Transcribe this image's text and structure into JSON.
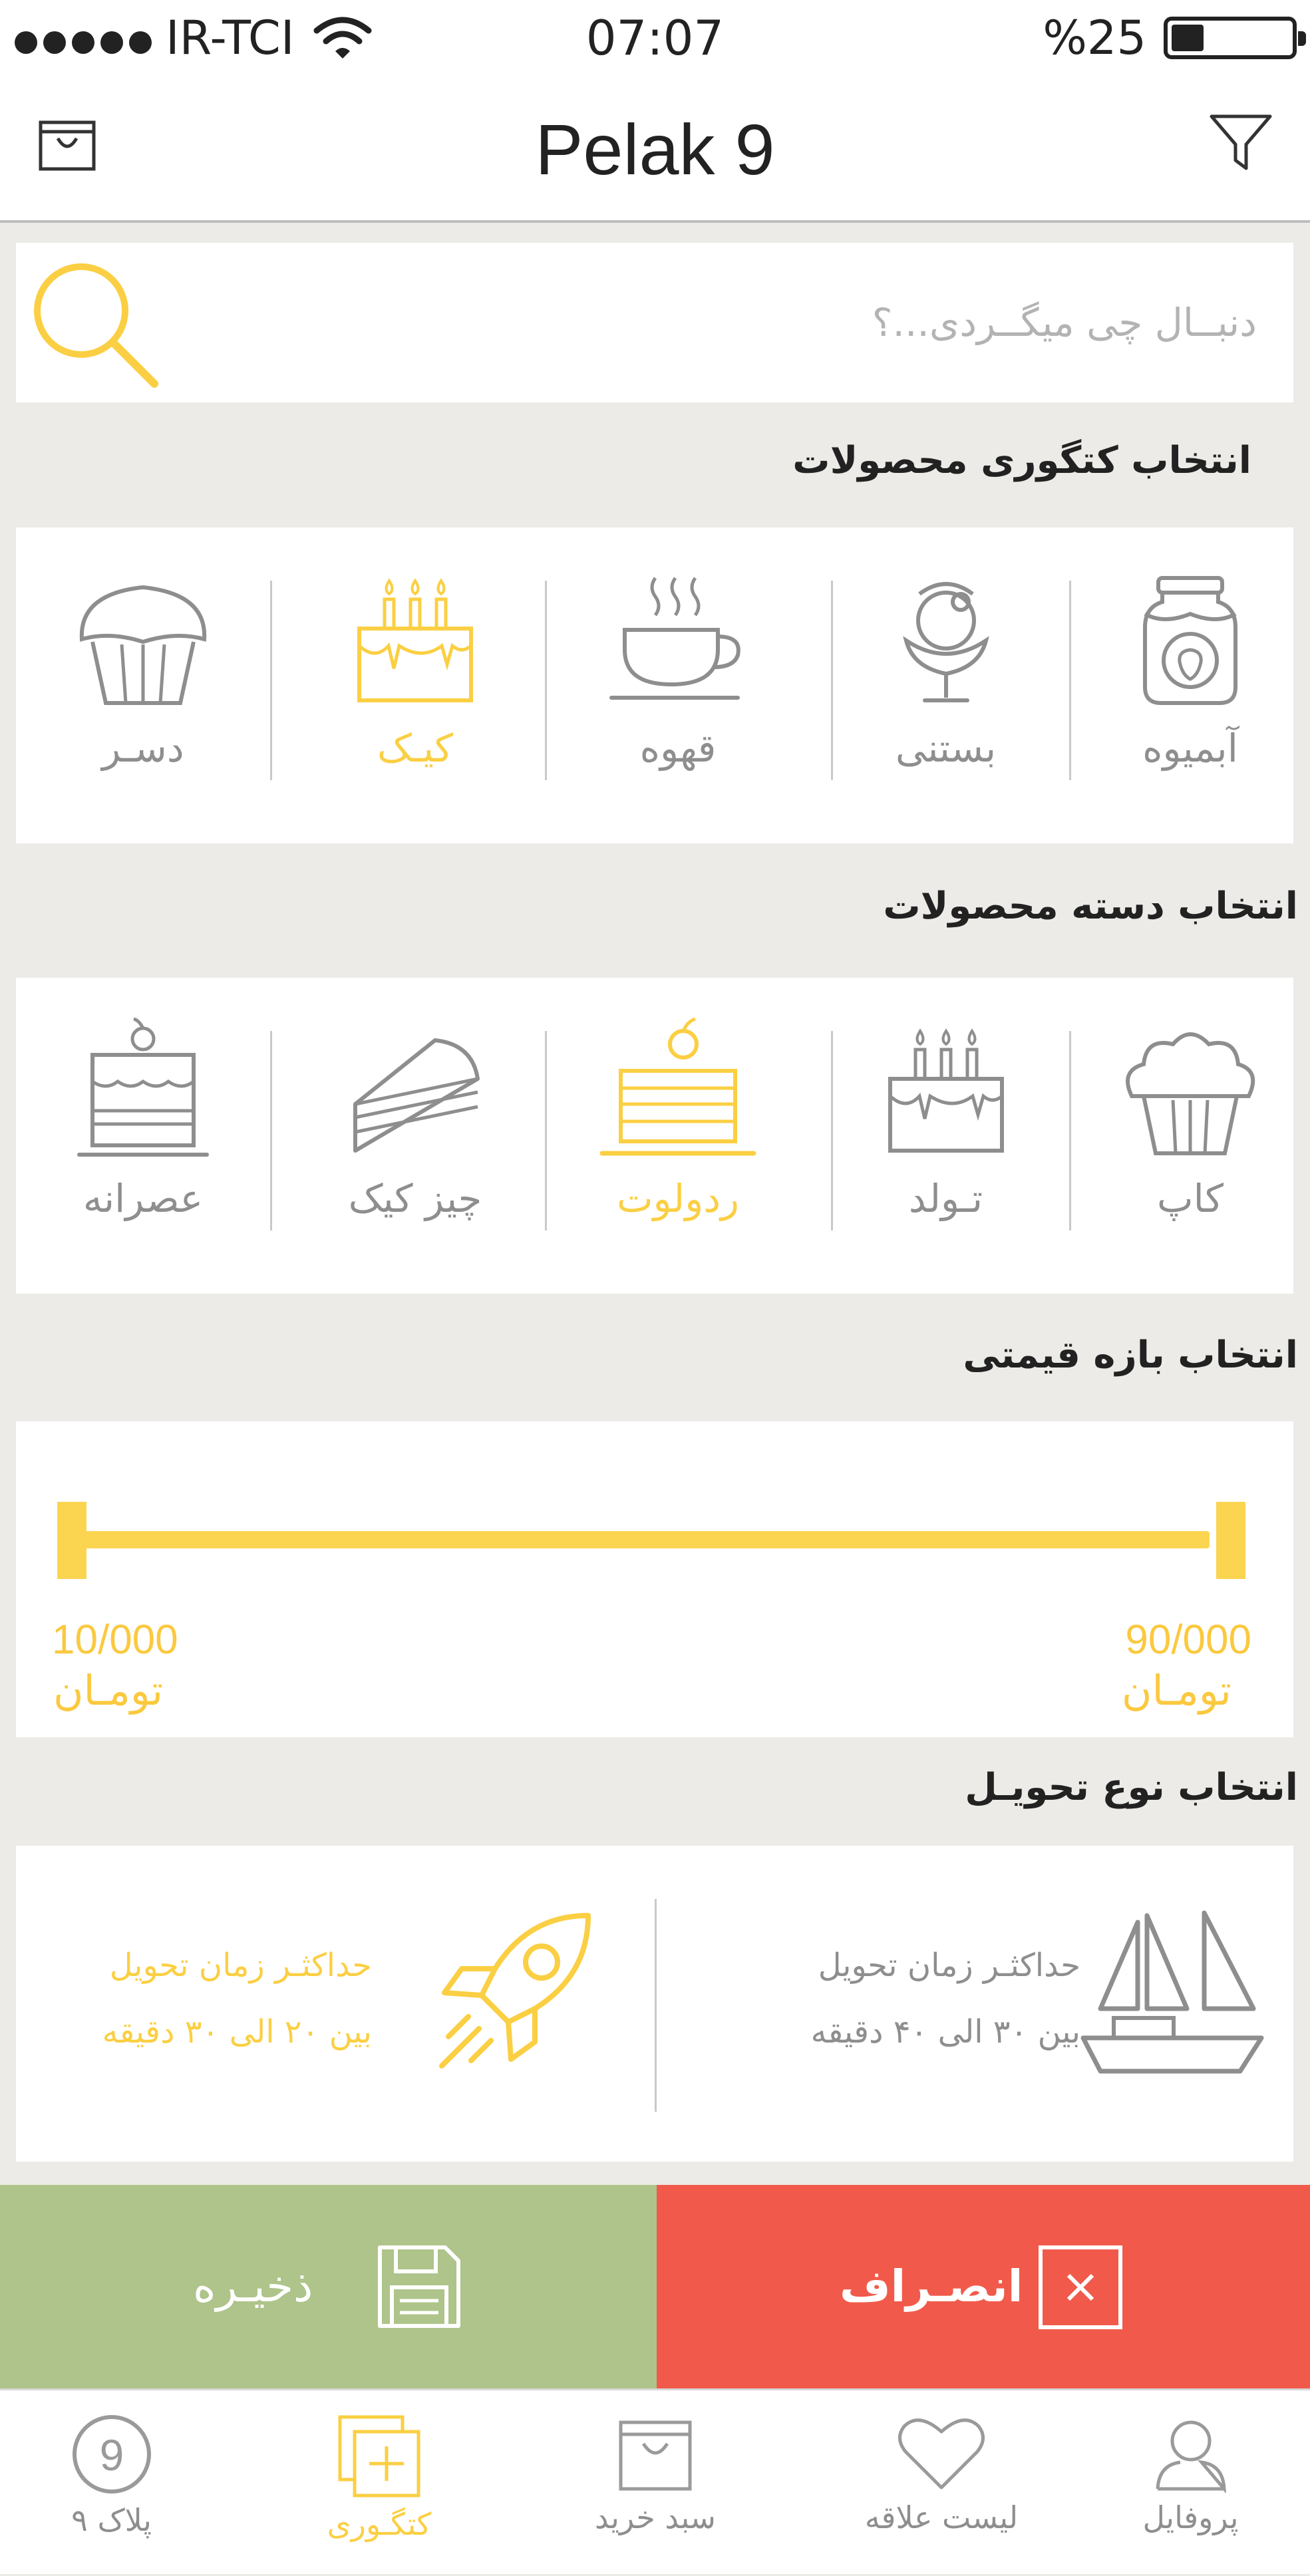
{
  "status_bar": {
    "carrier": "IR-TCI",
    "time": "07:07",
    "battery": "%25"
  },
  "nav": {
    "title": "Pelak 9"
  },
  "search": {
    "placeholder": "دنبــال چی میگــردی...؟"
  },
  "category_section": {
    "title": "انتخاب کتگوری محصولات",
    "items": [
      {
        "label": "آبمیوه",
        "icon": "jam-jar-icon",
        "selected": false
      },
      {
        "label": "بستنی",
        "icon": "ice-cream-icon",
        "selected": false
      },
      {
        "label": "قهوه",
        "icon": "coffee-cup-icon",
        "selected": false
      },
      {
        "label": "کیـک",
        "icon": "birthday-cake-icon",
        "selected": true
      },
      {
        "label": "دسـر",
        "icon": "muffin-icon",
        "selected": false
      }
    ]
  },
  "subcategory_section": {
    "title": "انتخاب دسته محصولات",
    "items": [
      {
        "label": "کاپ",
        "icon": "cupcake-icon",
        "selected": false
      },
      {
        "label": "تـولد",
        "icon": "birthday-cake-icon",
        "selected": false
      },
      {
        "label": "ردولوت",
        "icon": "roll-cake-icon",
        "selected": true
      },
      {
        "label": "چیز کیک",
        "icon": "cheesecake-slice-icon",
        "selected": false
      },
      {
        "label": "عصرانه",
        "icon": "layer-cake-icon",
        "selected": false
      }
    ]
  },
  "price_section": {
    "title": "انتخاب بازه قیمتی",
    "max_value": "90/000",
    "min_value": "10/000",
    "unit": "تومـان",
    "range_fraction": [
      0,
      1
    ]
  },
  "delivery_section": {
    "title": "انتخاب نوع تحویـل",
    "options": [
      {
        "line1": "حداکثـر زمان تحویل",
        "line2": "بین ۳۰ الی ۴۰ دقیقه",
        "icon": "ship-icon",
        "selected": false
      },
      {
        "line1": "حداکثـر زمان تحویل",
        "line2": "بین ۲۰ الی ۳۰ دقیقه",
        "icon": "rocket-icon",
        "selected": true
      }
    ]
  },
  "actions": {
    "save_label": "ذخیـره",
    "cancel_label": "انصـراف"
  },
  "tab_bar": {
    "items": [
      {
        "label": "پروفایل",
        "icon": "profile-icon",
        "active": false
      },
      {
        "label": "لیست علاقه",
        "icon": "heart-icon",
        "active": false
      },
      {
        "label": "سبد خرید",
        "icon": "shopping-bag-icon",
        "active": false
      },
      {
        "label": "کتگـوری",
        "icon": "category-icon",
        "active": true
      },
      {
        "label": "پلاک ۹",
        "icon": "pelak9-icon",
        "active": false
      }
    ],
    "badge": "9"
  },
  "colors": {
    "accent": "#fbcf43",
    "inactive": "#8e8e8e",
    "save": "#aec48a",
    "cancel": "#f15a4a",
    "background": "#ecebe7"
  }
}
